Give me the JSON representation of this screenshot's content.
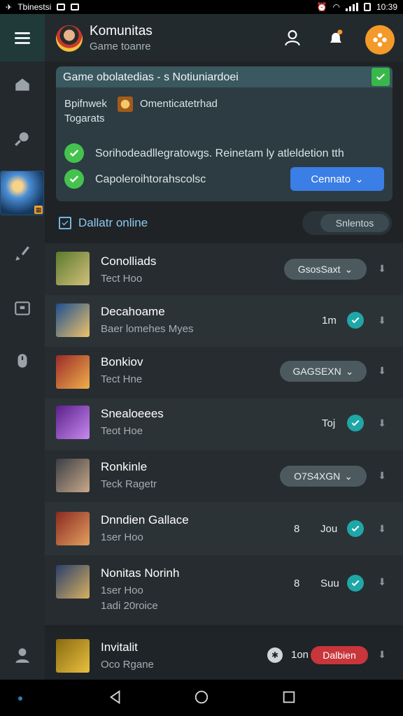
{
  "status_bar": {
    "left_text": "Tbinestsi",
    "time": "10:39"
  },
  "header": {
    "title": "Komunitas",
    "subtitle": "Game toanre"
  },
  "card": {
    "title": "Game obolatedias - s Notiuniardoei",
    "line1": "Bpifnwek",
    "line1_detail": "Omenticatetrhad",
    "line2": "Togarats",
    "item1": "Sorihodeadllegratowgs. Reinetam ly atleldetion tth",
    "item2": "Capoleroihtorahscolsc",
    "confirm_label": "Cennato"
  },
  "online_label": "Dallatr online",
  "filter_label": "Snlentos",
  "games": [
    {
      "name": "Conolliads",
      "sub": "Tect Hoo",
      "status": "GsosSaxt",
      "colors": [
        "#5b7a2e",
        "#d3c07a"
      ]
    },
    {
      "name": "Decahoame",
      "sub": "Baer lomehes Myes",
      "meta": "1m",
      "colors": [
        "#1d4f8f",
        "#f0c36a"
      ]
    },
    {
      "name": "Bonkiov",
      "sub": "Tect Hne",
      "status": "GAGSEXN",
      "colors": [
        "#9b2a2a",
        "#f0b04a"
      ]
    },
    {
      "name": "Snealoeees",
      "sub": "Teot Hoe",
      "meta": "Toj",
      "colors": [
        "#5a1f8a",
        "#c78af0"
      ]
    },
    {
      "name": "Ronkinle",
      "sub": "Teck Ragetr",
      "status": "O7S4XGN",
      "colors": [
        "#3b3e44",
        "#c9a98a"
      ]
    },
    {
      "name": "Dnndien Gallace",
      "sub": "1ser Hoo",
      "meta": "Jou",
      "meta_left": "8",
      "colors": [
        "#8a2a20",
        "#e3a060"
      ]
    },
    {
      "name": "Nonitas Norinh",
      "sub": "1ser Hoo",
      "sub2": "1adi 20roice",
      "meta": "Suu",
      "meta_left": "8",
      "colors": [
        "#2a3f6a",
        "#d9b060"
      ]
    },
    {
      "name": "Invitalit",
      "sub": "Oco Rgane",
      "meta": "1on",
      "status_red": "Dalbien",
      "colors": [
        "#8a6a10",
        "#e8c040"
      ]
    }
  ],
  "colors": {
    "accent_blue": "#3a7ee6",
    "accent_orange": "#f49a2a",
    "check_teal": "#1fa6a6",
    "green": "#45c24e",
    "red": "#c8353a"
  },
  "icons": [
    "menu-icon",
    "home-icon",
    "search-icon",
    "brush-icon",
    "box-icon",
    "mouse-icon",
    "user-icon",
    "bell-icon",
    "gamepad-icon"
  ]
}
